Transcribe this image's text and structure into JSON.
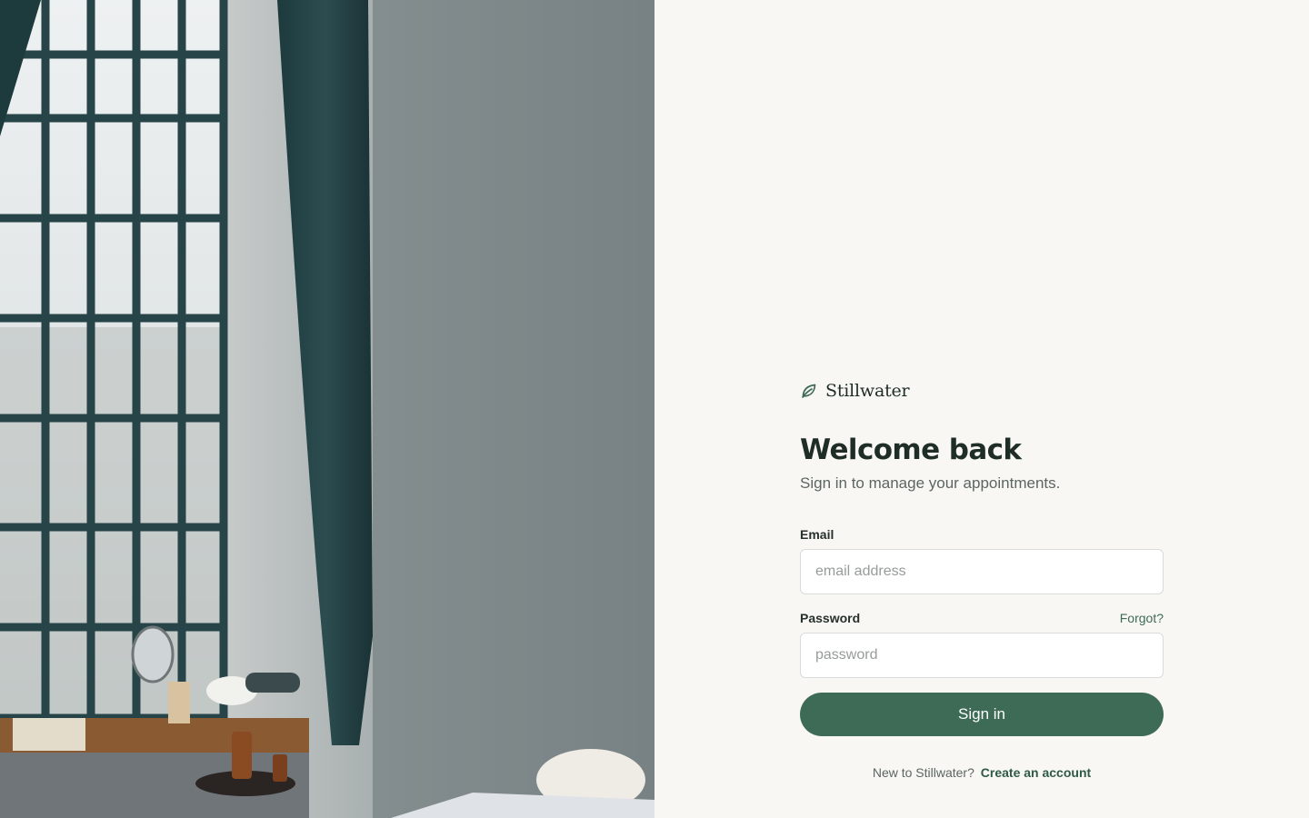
{
  "brand": {
    "name": "Stillwater",
    "icon": "leaf-icon",
    "accent": "#3e6b56"
  },
  "hero": {
    "title": "Welcome back",
    "subtitle": "Sign in to manage your appointments."
  },
  "email": {
    "label": "Email",
    "placeholder": "email address",
    "value": ""
  },
  "password": {
    "label": "Password",
    "placeholder": "password",
    "value": "",
    "forgot_label": "Forgot?"
  },
  "actions": {
    "signin_label": "Sign in"
  },
  "footer": {
    "prompt": "New to Stillwater?",
    "link_label": "Create an account"
  },
  "photo": {
    "subject": "spa-room-photo"
  }
}
